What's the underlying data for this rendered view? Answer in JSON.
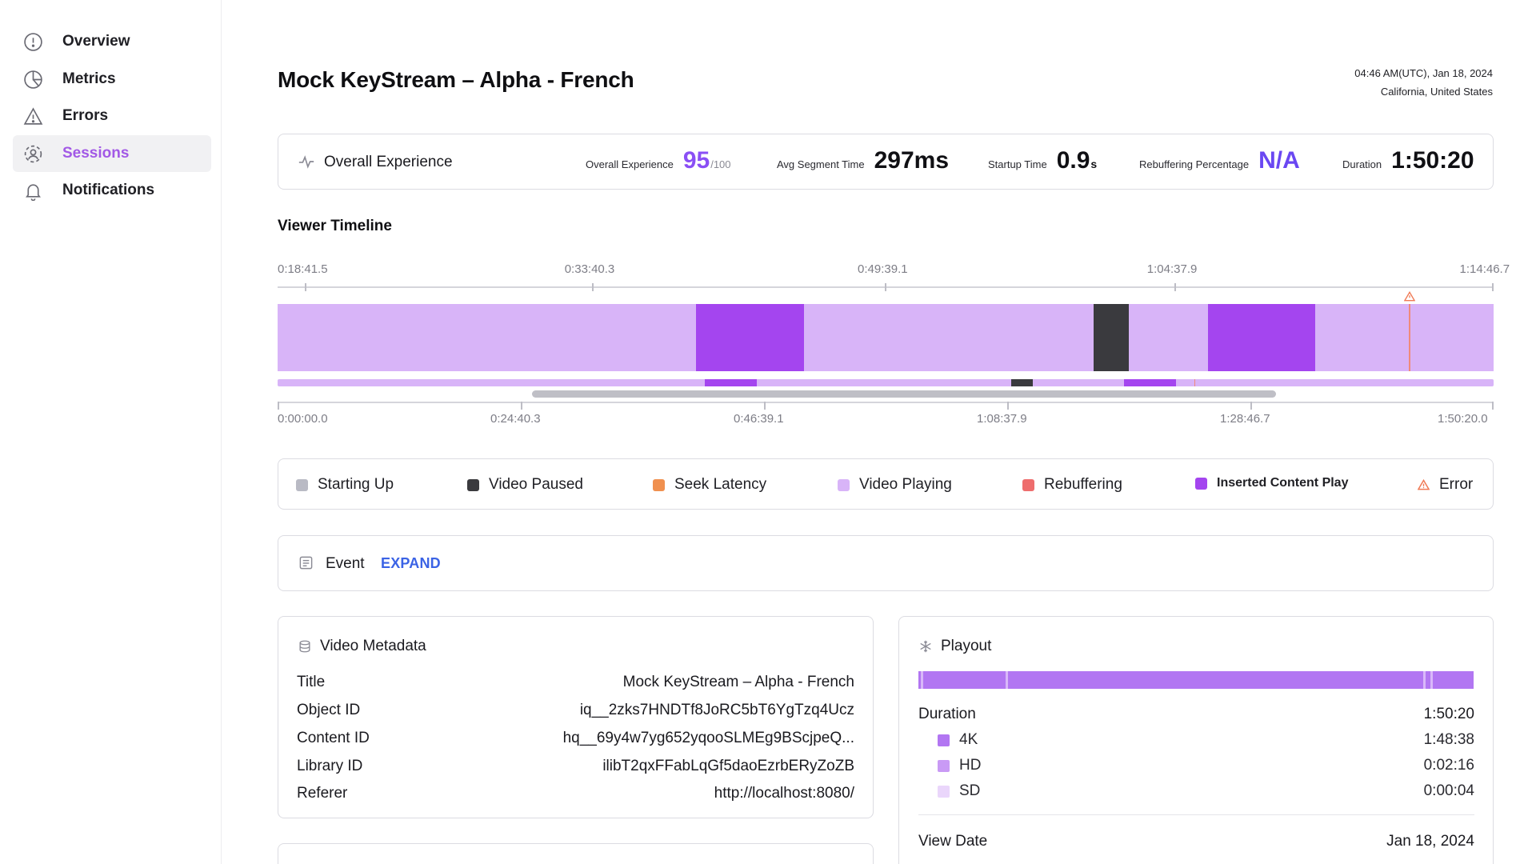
{
  "sidebar": {
    "items": [
      {
        "label": "Overview",
        "icon": "overview-icon",
        "active": false
      },
      {
        "label": "Metrics",
        "icon": "metrics-pie-icon",
        "active": false
      },
      {
        "label": "Errors",
        "icon": "warning-icon",
        "active": false
      },
      {
        "label": "Sessions",
        "icon": "sessions-icon",
        "active": true
      },
      {
        "label": "Notifications",
        "icon": "bell-icon",
        "active": false
      }
    ]
  },
  "header": {
    "title": "Mock KeyStream – Alpha - French",
    "datetime": "04:46 AM(UTC), Jan 18, 2024",
    "location": "California, United States"
  },
  "experience": {
    "title": "Overall Experience",
    "metrics": [
      {
        "label": "Overall Experience",
        "value": "95",
        "sub": "/100"
      },
      {
        "label": "Avg Segment Time",
        "value": "297ms",
        "sub": ""
      },
      {
        "label": "Startup Time",
        "value": "0.9",
        "sub": "s"
      },
      {
        "label": "Rebuffering Percentage",
        "value": "N/A",
        "sub": ""
      },
      {
        "label": "Duration",
        "value": "1:50:20",
        "sub": ""
      }
    ]
  },
  "timeline": {
    "title": "Viewer Timeline",
    "top_ticks": [
      "0:18:41.5",
      "0:33:40.3",
      "0:49:39.1",
      "1:04:37.9",
      "1:14:46.7"
    ],
    "bottom_ticks": [
      "0:00:00.0",
      "0:24:40.3",
      "0:46:39.1",
      "1:08:37.9",
      "1:28:46.7",
      "1:50:20.0"
    ],
    "zoom_window": {
      "start_fraction": 0.17,
      "end_fraction": 0.68
    },
    "segments": [
      {
        "state": "Inserted Content Play",
        "start": 0.344,
        "end": 0.433
      },
      {
        "state": "Video Paused",
        "start": 0.672,
        "end": 0.701
      },
      {
        "state": "Inserted Content Play",
        "start": 0.764,
        "end": 0.853
      }
    ],
    "error_at": 0.93
  },
  "legend": {
    "items": [
      {
        "label": "Starting Up",
        "color": "#b9bac4"
      },
      {
        "label": "Video Paused",
        "color": "#3a3a3e"
      },
      {
        "label": "Seek Latency",
        "color": "#f0904f"
      },
      {
        "label": "Video Playing",
        "color": "#d8b4f8"
      },
      {
        "label": "Rebuffering",
        "color": "#ee6d6d"
      },
      {
        "label": "Inserted Content Play",
        "color": "#a445ef"
      },
      {
        "label": "Error",
        "color": "#f07a55"
      }
    ]
  },
  "event": {
    "label": "Event",
    "expand_label": "EXPAND"
  },
  "video_metadata": {
    "title": "Video Metadata",
    "rows": [
      {
        "key": "Title",
        "value": "Mock KeyStream – Alpha - French"
      },
      {
        "key": "Object ID",
        "value": "iq__2zks7HNDTf8JoRC5bT6YgTzq4Ucz"
      },
      {
        "key": "Content ID",
        "value": "hq__69y4w7yg652yqooSLMEg9BScjpeQ..."
      },
      {
        "key": "Library ID",
        "value": "ilibT2qxFFabLqGf5daoEzrbERyZoZB"
      },
      {
        "key": "Referer",
        "value": "http://localhost:8080/"
      }
    ]
  },
  "playout": {
    "title": "Playout",
    "duration_label": "Duration",
    "duration_value": "1:50:20",
    "qualities": [
      {
        "label": "4K",
        "value": "1:48:38",
        "color": "#b276f2"
      },
      {
        "label": "HD",
        "value": "0:02:16",
        "color": "#c99af5"
      },
      {
        "label": "SD",
        "value": "0:00:04",
        "color": "#ead6fb"
      }
    ],
    "view_date_label": "View Date",
    "view_date_value": "Jan 18, 2024"
  },
  "colors": {
    "accent": "#a259e6",
    "link": "#3b63e5",
    "playing": "#d8b4f8",
    "inserted": "#a445ef",
    "paused": "#3a3a3e"
  }
}
